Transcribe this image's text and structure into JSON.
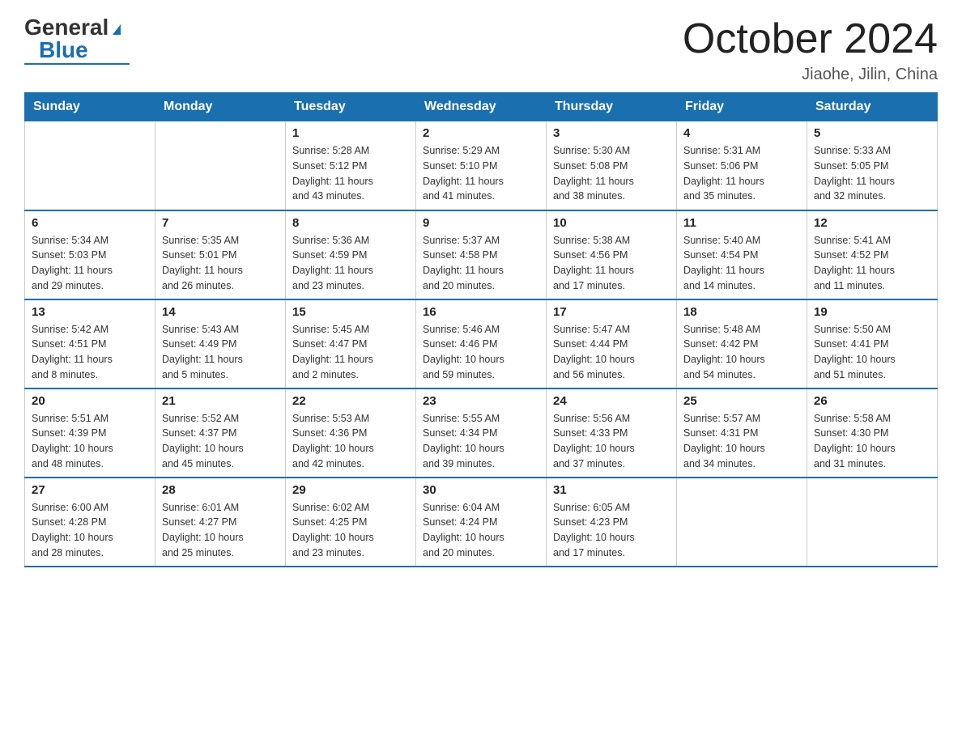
{
  "header": {
    "logo_general": "General",
    "logo_blue": "Blue",
    "month_title": "October 2024",
    "location": "Jiaohe, Jilin, China"
  },
  "days_of_week": [
    "Sunday",
    "Monday",
    "Tuesday",
    "Wednesday",
    "Thursday",
    "Friday",
    "Saturday"
  ],
  "weeks": [
    [
      {
        "day": "",
        "info": ""
      },
      {
        "day": "",
        "info": ""
      },
      {
        "day": "1",
        "info": "Sunrise: 5:28 AM\nSunset: 5:12 PM\nDaylight: 11 hours\nand 43 minutes."
      },
      {
        "day": "2",
        "info": "Sunrise: 5:29 AM\nSunset: 5:10 PM\nDaylight: 11 hours\nand 41 minutes."
      },
      {
        "day": "3",
        "info": "Sunrise: 5:30 AM\nSunset: 5:08 PM\nDaylight: 11 hours\nand 38 minutes."
      },
      {
        "day": "4",
        "info": "Sunrise: 5:31 AM\nSunset: 5:06 PM\nDaylight: 11 hours\nand 35 minutes."
      },
      {
        "day": "5",
        "info": "Sunrise: 5:33 AM\nSunset: 5:05 PM\nDaylight: 11 hours\nand 32 minutes."
      }
    ],
    [
      {
        "day": "6",
        "info": "Sunrise: 5:34 AM\nSunset: 5:03 PM\nDaylight: 11 hours\nand 29 minutes."
      },
      {
        "day": "7",
        "info": "Sunrise: 5:35 AM\nSunset: 5:01 PM\nDaylight: 11 hours\nand 26 minutes."
      },
      {
        "day": "8",
        "info": "Sunrise: 5:36 AM\nSunset: 4:59 PM\nDaylight: 11 hours\nand 23 minutes."
      },
      {
        "day": "9",
        "info": "Sunrise: 5:37 AM\nSunset: 4:58 PM\nDaylight: 11 hours\nand 20 minutes."
      },
      {
        "day": "10",
        "info": "Sunrise: 5:38 AM\nSunset: 4:56 PM\nDaylight: 11 hours\nand 17 minutes."
      },
      {
        "day": "11",
        "info": "Sunrise: 5:40 AM\nSunset: 4:54 PM\nDaylight: 11 hours\nand 14 minutes."
      },
      {
        "day": "12",
        "info": "Sunrise: 5:41 AM\nSunset: 4:52 PM\nDaylight: 11 hours\nand 11 minutes."
      }
    ],
    [
      {
        "day": "13",
        "info": "Sunrise: 5:42 AM\nSunset: 4:51 PM\nDaylight: 11 hours\nand 8 minutes."
      },
      {
        "day": "14",
        "info": "Sunrise: 5:43 AM\nSunset: 4:49 PM\nDaylight: 11 hours\nand 5 minutes."
      },
      {
        "day": "15",
        "info": "Sunrise: 5:45 AM\nSunset: 4:47 PM\nDaylight: 11 hours\nand 2 minutes."
      },
      {
        "day": "16",
        "info": "Sunrise: 5:46 AM\nSunset: 4:46 PM\nDaylight: 10 hours\nand 59 minutes."
      },
      {
        "day": "17",
        "info": "Sunrise: 5:47 AM\nSunset: 4:44 PM\nDaylight: 10 hours\nand 56 minutes."
      },
      {
        "day": "18",
        "info": "Sunrise: 5:48 AM\nSunset: 4:42 PM\nDaylight: 10 hours\nand 54 minutes."
      },
      {
        "day": "19",
        "info": "Sunrise: 5:50 AM\nSunset: 4:41 PM\nDaylight: 10 hours\nand 51 minutes."
      }
    ],
    [
      {
        "day": "20",
        "info": "Sunrise: 5:51 AM\nSunset: 4:39 PM\nDaylight: 10 hours\nand 48 minutes."
      },
      {
        "day": "21",
        "info": "Sunrise: 5:52 AM\nSunset: 4:37 PM\nDaylight: 10 hours\nand 45 minutes."
      },
      {
        "day": "22",
        "info": "Sunrise: 5:53 AM\nSunset: 4:36 PM\nDaylight: 10 hours\nand 42 minutes."
      },
      {
        "day": "23",
        "info": "Sunrise: 5:55 AM\nSunset: 4:34 PM\nDaylight: 10 hours\nand 39 minutes."
      },
      {
        "day": "24",
        "info": "Sunrise: 5:56 AM\nSunset: 4:33 PM\nDaylight: 10 hours\nand 37 minutes."
      },
      {
        "day": "25",
        "info": "Sunrise: 5:57 AM\nSunset: 4:31 PM\nDaylight: 10 hours\nand 34 minutes."
      },
      {
        "day": "26",
        "info": "Sunrise: 5:58 AM\nSunset: 4:30 PM\nDaylight: 10 hours\nand 31 minutes."
      }
    ],
    [
      {
        "day": "27",
        "info": "Sunrise: 6:00 AM\nSunset: 4:28 PM\nDaylight: 10 hours\nand 28 minutes."
      },
      {
        "day": "28",
        "info": "Sunrise: 6:01 AM\nSunset: 4:27 PM\nDaylight: 10 hours\nand 25 minutes."
      },
      {
        "day": "29",
        "info": "Sunrise: 6:02 AM\nSunset: 4:25 PM\nDaylight: 10 hours\nand 23 minutes."
      },
      {
        "day": "30",
        "info": "Sunrise: 6:04 AM\nSunset: 4:24 PM\nDaylight: 10 hours\nand 20 minutes."
      },
      {
        "day": "31",
        "info": "Sunrise: 6:05 AM\nSunset: 4:23 PM\nDaylight: 10 hours\nand 17 minutes."
      },
      {
        "day": "",
        "info": ""
      },
      {
        "day": "",
        "info": ""
      }
    ]
  ]
}
